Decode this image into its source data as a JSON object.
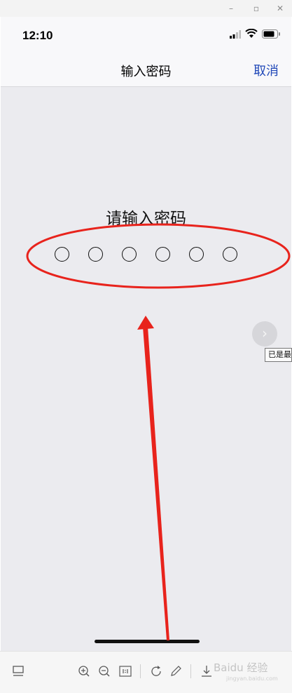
{
  "status": {
    "time": "12:10"
  },
  "nav": {
    "title": "输入密码",
    "cancel_label": "取消"
  },
  "prompt": "请输入密码",
  "password_length": 6,
  "side_tooltip": "已是最后一张",
  "watermark": {
    "text": "Baidu 经验",
    "sub": "jingyan.baidu.com"
  },
  "colors": {
    "accent": "#2048b8",
    "annotation": "#e8231c",
    "background": "#ebebef"
  }
}
